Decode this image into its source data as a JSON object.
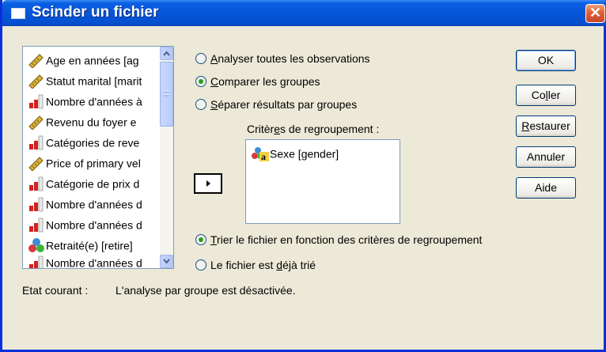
{
  "window": {
    "title": "Scinder un fichier",
    "close_glyph": "✕"
  },
  "variables": [
    {
      "label": "Age en années [ag",
      "icon": "scale-icon"
    },
    {
      "label": "Statut marital [marit",
      "icon": "scale-icon"
    },
    {
      "label": "Nombre d'années à",
      "icon": "ordinal-icon"
    },
    {
      "label": "Revenu du foyer e",
      "icon": "scale-icon"
    },
    {
      "label": "Catégories de reve",
      "icon": "ordinal-icon"
    },
    {
      "label": "Price of primary vel",
      "icon": "scale-icon"
    },
    {
      "label": "Catégorie de prix d",
      "icon": "ordinal-icon"
    },
    {
      "label": "Nombre d'années d",
      "icon": "ordinal-icon"
    },
    {
      "label": "Nombre d'années d",
      "icon": "ordinal-icon"
    },
    {
      "label": "Retraité(e) [retire]",
      "icon": "nominal-icon"
    },
    {
      "label": "Nombre d'années d",
      "icon": "ordinal-icon"
    }
  ],
  "mode_options": {
    "analyse_all": {
      "pre": "",
      "ul": "A",
      "post": "nalyser toutes les observations",
      "selected": false
    },
    "compare": {
      "pre": "",
      "ul": "C",
      "post": "omparer les groupes",
      "selected": true
    },
    "separate": {
      "pre": "",
      "ul": "S",
      "post": "éparer résultats par groupes",
      "selected": false
    }
  },
  "grouping": {
    "label_pre": "Critèr",
    "label_ul": "e",
    "label_post": "s de regroupement :",
    "items": [
      {
        "label": "Sexe [gender]",
        "icon": "nominal-string-icon"
      }
    ]
  },
  "sort_options": {
    "sort": {
      "pre": "",
      "ul": "T",
      "post": "rier le fichier en fonction des critères de regroupement",
      "selected": true
    },
    "sorted": {
      "pre": "Le fichier est ",
      "ul": "d",
      "post": "éjà trié",
      "selected": false
    }
  },
  "buttons": {
    "ok": {
      "pre": "",
      "ul": "",
      "post": "OK"
    },
    "paste": {
      "pre": "Co",
      "ul": "l",
      "post": "ler"
    },
    "reset": {
      "pre": "",
      "ul": "R",
      "post": "estaurer"
    },
    "cancel": {
      "pre": "",
      "ul": "",
      "post": "Annuler"
    },
    "help": {
      "pre": "",
      "ul": "",
      "post": "Aide"
    }
  },
  "status": {
    "label": "Etat courant :",
    "value": "L'analyse par groupe est désactivée."
  },
  "colors": {
    "titlebar": "#0756d8",
    "dialog_bg": "#ece9d8",
    "radio_dot": "#21a121",
    "close_button": "#e0663a"
  }
}
